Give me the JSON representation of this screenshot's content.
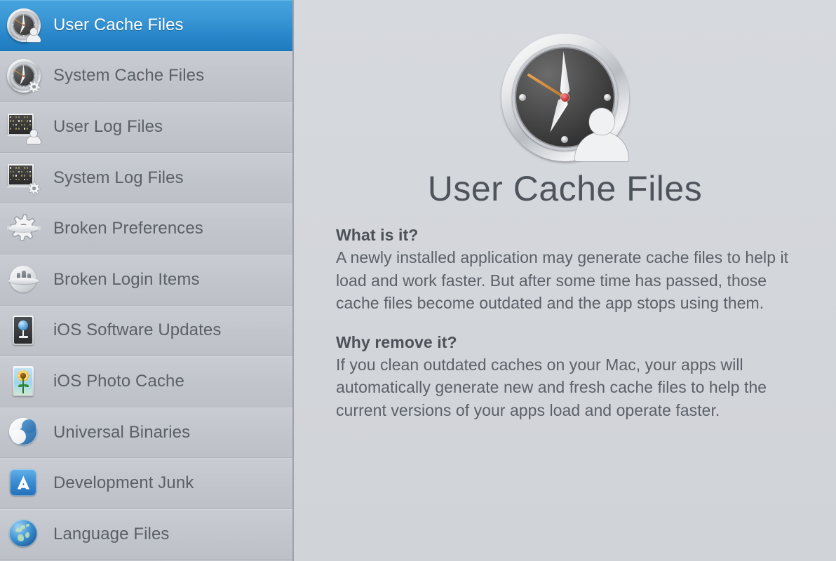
{
  "window": {
    "background_color": "#d4d7dc",
    "accent_color": "#2e8fd0"
  },
  "sidebar": {
    "selected_index": 0,
    "items": [
      {
        "label": "User Cache Files",
        "icon": "user-cache-clock-icon",
        "selected": true
      },
      {
        "label": "System Cache Files",
        "icon": "system-cache-clock-gear-icon",
        "selected": false
      },
      {
        "label": "User Log Files",
        "icon": "user-log-board-icon",
        "selected": false
      },
      {
        "label": "System Log Files",
        "icon": "system-log-board-gear-icon",
        "selected": false
      },
      {
        "label": "Broken Preferences",
        "icon": "broken-gear-icon",
        "selected": false
      },
      {
        "label": "Broken Login Items",
        "icon": "broken-login-circle-icon",
        "selected": false
      },
      {
        "label": "iOS Software Updates",
        "icon": "ios-update-frame-icon",
        "selected": false
      },
      {
        "label": "iOS Photo Cache",
        "icon": "ios-photo-sunflower-icon",
        "selected": false
      },
      {
        "label": "Universal Binaries",
        "icon": "universal-binaries-yin-icon",
        "selected": false
      },
      {
        "label": "Development Junk",
        "icon": "xcode-a-icon",
        "selected": false
      },
      {
        "label": "Language Files",
        "icon": "globe-icon",
        "selected": false
      }
    ]
  },
  "detail": {
    "hero_icon": "user-cache-clock-icon-large",
    "title": "User Cache Files",
    "sections": [
      {
        "heading": "What is it?",
        "body": "A newly installed application may generate cache files to help it load and work faster. But after some time has passed, those cache files become outdated and the app stops using them."
      },
      {
        "heading": "Why remove it?",
        "body": "If you clean outdated caches on your Mac, your apps will automatically generate new and fresh cache files to help the current versions of your apps load and operate faster."
      }
    ]
  }
}
